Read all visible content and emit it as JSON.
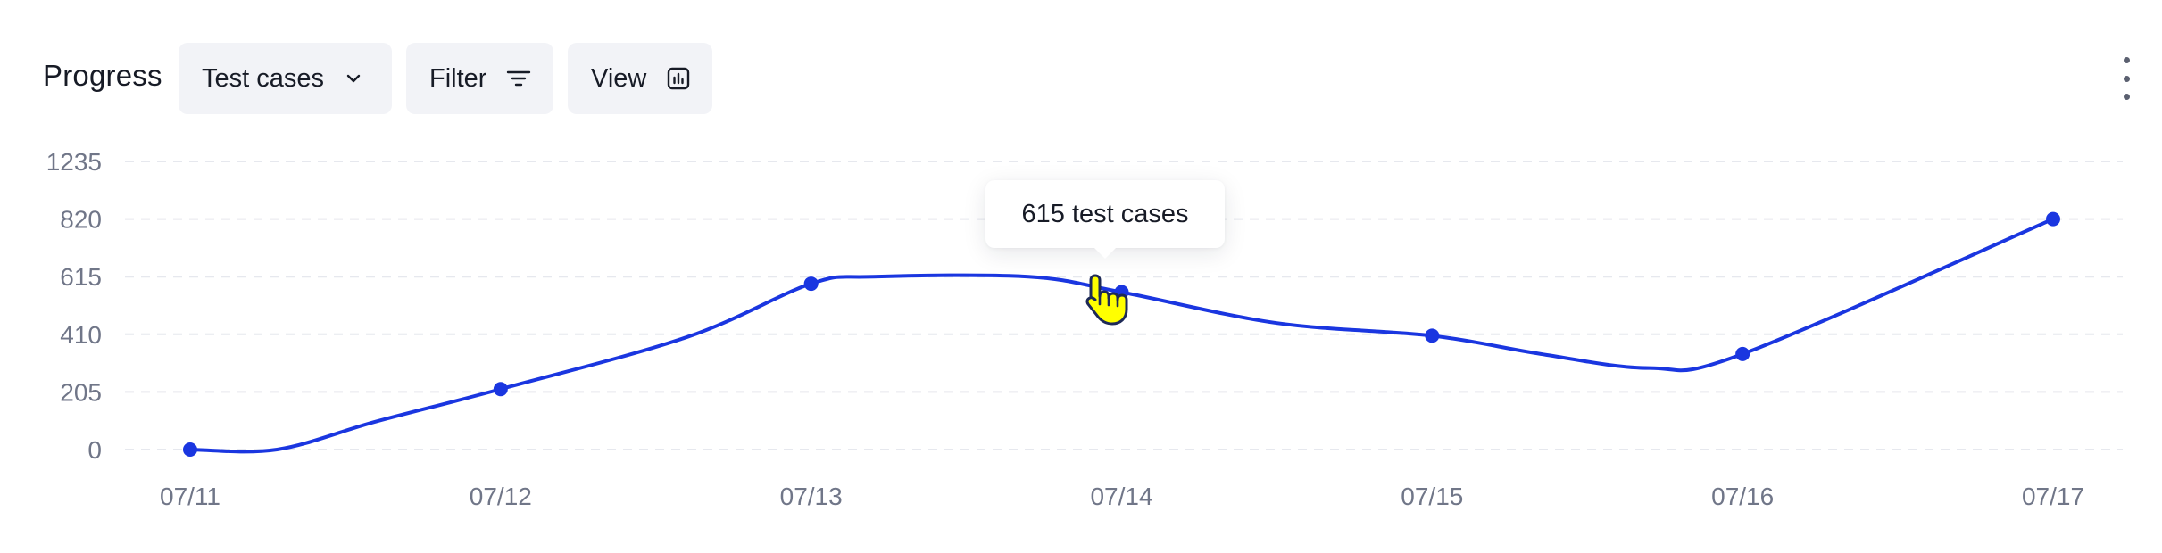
{
  "header": {
    "title": "Progress",
    "metric_select": {
      "value": "Test cases",
      "icon": "chevron-down-icon"
    },
    "filter_button": {
      "label": "Filter",
      "icon": "filter-lines-icon"
    },
    "view_button": {
      "label": "View",
      "icon": "bar-chart-square-icon"
    },
    "more_menu": {
      "icon": "vertical-ellipsis-icon"
    }
  },
  "tooltip": {
    "text": "615 test cases"
  },
  "colors": {
    "line": "#1a36e0",
    "grid": "#e6e8ee",
    "tick": "#707688",
    "button_bg": "#f2f3f7"
  },
  "chart_data": {
    "type": "line",
    "categories": [
      "07/11",
      "07/12",
      "07/13",
      "07/14",
      "07/15",
      "07/16",
      "07/17"
    ],
    "yticks": [
      0,
      205,
      410,
      615,
      820,
      1235
    ],
    "ylim": [
      0,
      1235
    ],
    "grid": true,
    "series": [
      {
        "values": [
          0,
          215,
          590,
          560,
          405,
          340,
          820
        ],
        "curve_points": [
          {
            "x": "07/11",
            "y": 0
          },
          {
            "x": "07/11",
            "y": 0,
            "offset": 0.28
          },
          {
            "x": "07/11",
            "y": 100,
            "offset": 0.6
          },
          {
            "x": "07/12",
            "y": 215
          },
          {
            "x": "07/12",
            "y": 400,
            "offset": 0.6
          },
          {
            "x": "07/13",
            "y": 590
          },
          {
            "x": "07/13",
            "y": 615,
            "offset": 0.2
          },
          {
            "x": "07/13",
            "y": 615,
            "offset": 0.7
          },
          {
            "x": "07/14",
            "y": 560
          },
          {
            "x": "07/14",
            "y": 450,
            "offset": 0.5
          },
          {
            "x": "07/15",
            "y": 405
          },
          {
            "x": "07/15",
            "y": 340,
            "offset": 0.35
          },
          {
            "x": "07/15",
            "y": 290,
            "offset": 0.7
          },
          {
            "x": "07/16",
            "y": 340
          },
          {
            "x": "07/17",
            "y": 820
          }
        ]
      }
    ]
  }
}
